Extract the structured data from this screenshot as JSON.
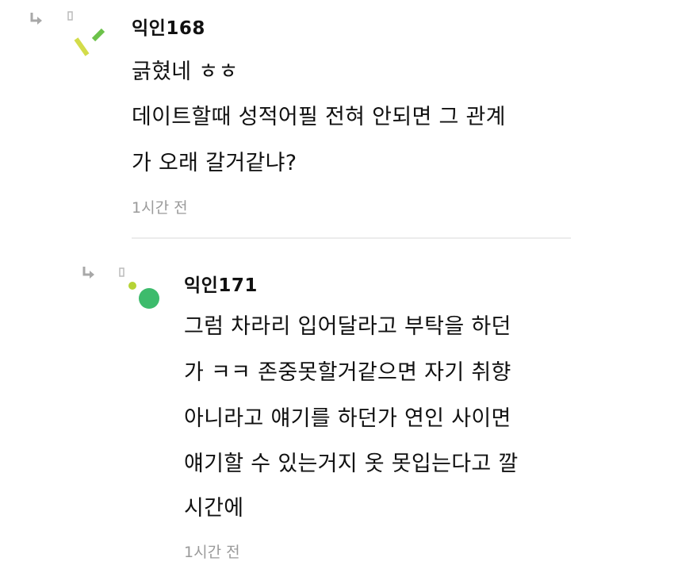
{
  "comments": [
    {
      "author": "익인168",
      "lines": [
        "긁혔네 ㅎㅎ",
        "데이트할때 성적어필 전혀 안되면 그 관계",
        "가 오래 갈거같냐?"
      ],
      "time": "1시간 전"
    },
    {
      "author": "익인171",
      "lines": [
        "그럼 차라리 입어달라고 부탁을 하던",
        "가 ㅋㅋ 존중못할거같으면 자기 취향",
        "아니라고 얘기를 하던가 연인 사이면",
        "얘기할 수 있는거지 옷 못입는다고 깔",
        "시간에"
      ],
      "time": "1시간 전"
    }
  ],
  "colors": {
    "text": "#111111",
    "time": "#9a9a9a",
    "divider": "#ececec",
    "reply_arrow": "#a8a8a8",
    "avatar1_yellow": "#d3dc4a",
    "avatar1_green": "#6cc24a",
    "avatar2_green": "#3dbb6c",
    "avatar2_lime": "#b5d335"
  }
}
